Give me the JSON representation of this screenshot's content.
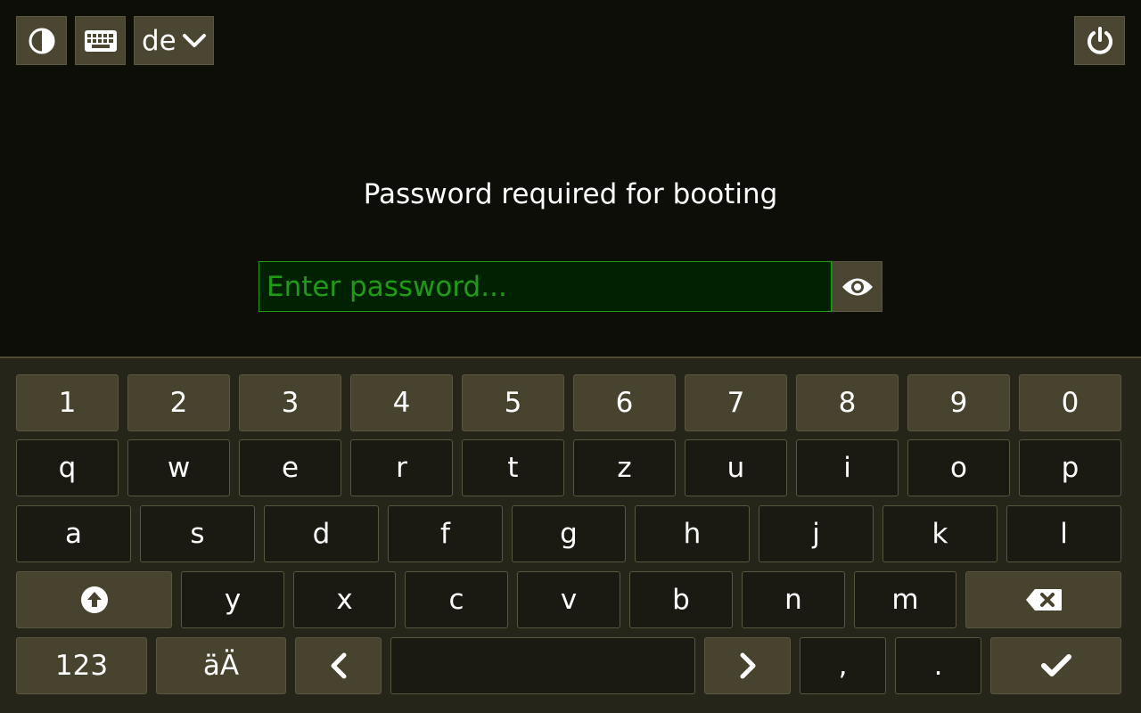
{
  "topbar": {
    "layout_label": "de",
    "icons": {
      "theme": "contrast-icon",
      "keyboard": "keyboard-icon",
      "layout_chevron": "chevron-down-icon",
      "power": "power-icon"
    }
  },
  "prompt": {
    "text": "Password required for booting"
  },
  "password": {
    "placeholder": "Enter password...",
    "value": "",
    "toggle_icon": "eye-icon"
  },
  "keyboard": {
    "row1": [
      "1",
      "2",
      "3",
      "4",
      "5",
      "6",
      "7",
      "8",
      "9",
      "0"
    ],
    "row2": [
      "q",
      "w",
      "e",
      "r",
      "t",
      "z",
      "u",
      "i",
      "o",
      "p"
    ],
    "row3": [
      "a",
      "s",
      "d",
      "f",
      "g",
      "h",
      "j",
      "k",
      "l"
    ],
    "row4": [
      "y",
      "x",
      "c",
      "v",
      "b",
      "n",
      "m"
    ],
    "row4_icons": {
      "shift": "shift-arrow-icon",
      "backspace": "backspace-icon"
    },
    "row5": {
      "numbers_label": "123",
      "umlaut_label": "äÄ",
      "comma_label": ",",
      "period_label": ".",
      "icons": {
        "left": "chevron-left-icon",
        "right": "chevron-right-icon",
        "enter": "checkmark-icon"
      }
    }
  },
  "colors": {
    "background": "#0e0e09",
    "button": "#4a4632",
    "accent_green": "#1f9b16",
    "field_bg": "#002203",
    "key_bg": "#1b1a12",
    "keyboard_bg": "#262519"
  }
}
